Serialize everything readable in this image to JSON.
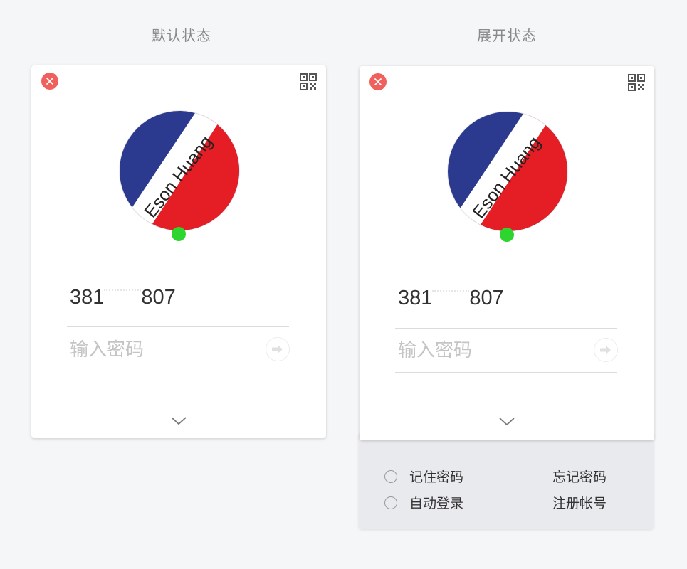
{
  "titles": {
    "default_state": "默认状态",
    "expanded_state": "展开状态"
  },
  "login": {
    "account": "381",
    "account_suffix": "807",
    "password_placeholder": "输入密码",
    "avatar_text": "Eson Huang"
  },
  "options": {
    "remember_password": "记住密码",
    "auto_login": "自动登录",
    "forgot_password": "忘记密码",
    "register_account": "注册帐号"
  },
  "colors": {
    "close": "#f0605c",
    "online": "#2ed52e",
    "avatar_blue": "#2b3a8e",
    "avatar_red": "#e51d24"
  }
}
